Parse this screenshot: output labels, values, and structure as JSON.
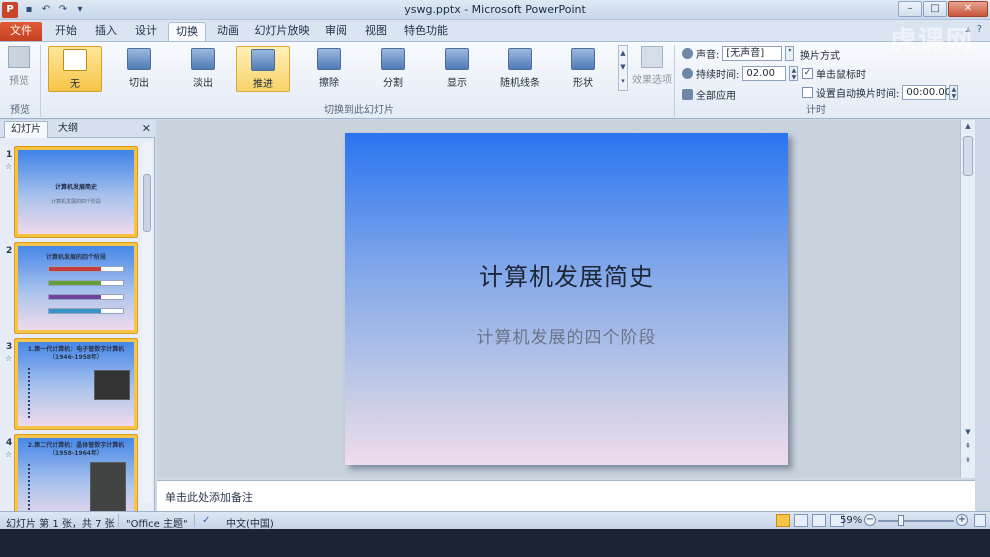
{
  "window": {
    "title": "yswg.pptx - Microsoft PowerPoint",
    "app_icon_letter": "P"
  },
  "tabs": [
    {
      "label": "文件"
    },
    {
      "label": "开始"
    },
    {
      "label": "插入"
    },
    {
      "label": "设计"
    },
    {
      "label": "切换"
    },
    {
      "label": "动画"
    },
    {
      "label": "幻灯片放映"
    },
    {
      "label": "审阅"
    },
    {
      "label": "视图"
    },
    {
      "label": "特色功能"
    }
  ],
  "ribbon": {
    "preview_label": "预览",
    "preview_group": "预览",
    "transitions_group": "切换到此幻灯片",
    "transitions": [
      {
        "label": "无",
        "icon": "blank-slide-icon"
      },
      {
        "label": "切出",
        "icon": "cut-icon"
      },
      {
        "label": "淡出",
        "icon": "fade-icon"
      },
      {
        "label": "推进",
        "icon": "push-icon"
      },
      {
        "label": "擦除",
        "icon": "wipe-icon"
      },
      {
        "label": "分割",
        "icon": "split-icon"
      },
      {
        "label": "显示",
        "icon": "reveal-icon"
      },
      {
        "label": "随机线条",
        "icon": "random-bars-icon"
      },
      {
        "label": "形状",
        "icon": "shape-icon"
      }
    ],
    "effect_options": "效果选项",
    "timing_group": "计时",
    "sound_label": "声音:",
    "sound_value": "[无声音]",
    "duration_label": "持续时间:",
    "duration_value": "02.00",
    "apply_all": "全部应用",
    "advance_label": "换片方式",
    "on_click_label": "单击鼠标时",
    "auto_after_label": "设置自动换片时间:",
    "auto_after_value": "00:00.00"
  },
  "panel": {
    "tab_slides": "幻灯片",
    "tab_outline": "大纲",
    "thumbs": [
      {
        "num": "1",
        "title": "计算机发展简史",
        "sub": "计算机发展的四个阶段"
      },
      {
        "num": "2",
        "title": "计算机发展的四个阶段"
      },
      {
        "num": "3",
        "title": "1.第一代计算机：电子管数字计算机（1946-1958年）"
      },
      {
        "num": "4",
        "title": "2.第二代计算机：晶体管数字计算机（1958-1964年）"
      }
    ]
  },
  "slide": {
    "title": "计算机发展简史",
    "subtitle": "计算机发展的四个阶段"
  },
  "notes": {
    "placeholder": "单击此处添加备注"
  },
  "status": {
    "slide_info": "幻灯片 第 1 张，共 7 张",
    "theme": "\"Office 主题\"",
    "language": "中文(中国)",
    "zoom": "59%"
  },
  "watermark": "虎课网"
}
